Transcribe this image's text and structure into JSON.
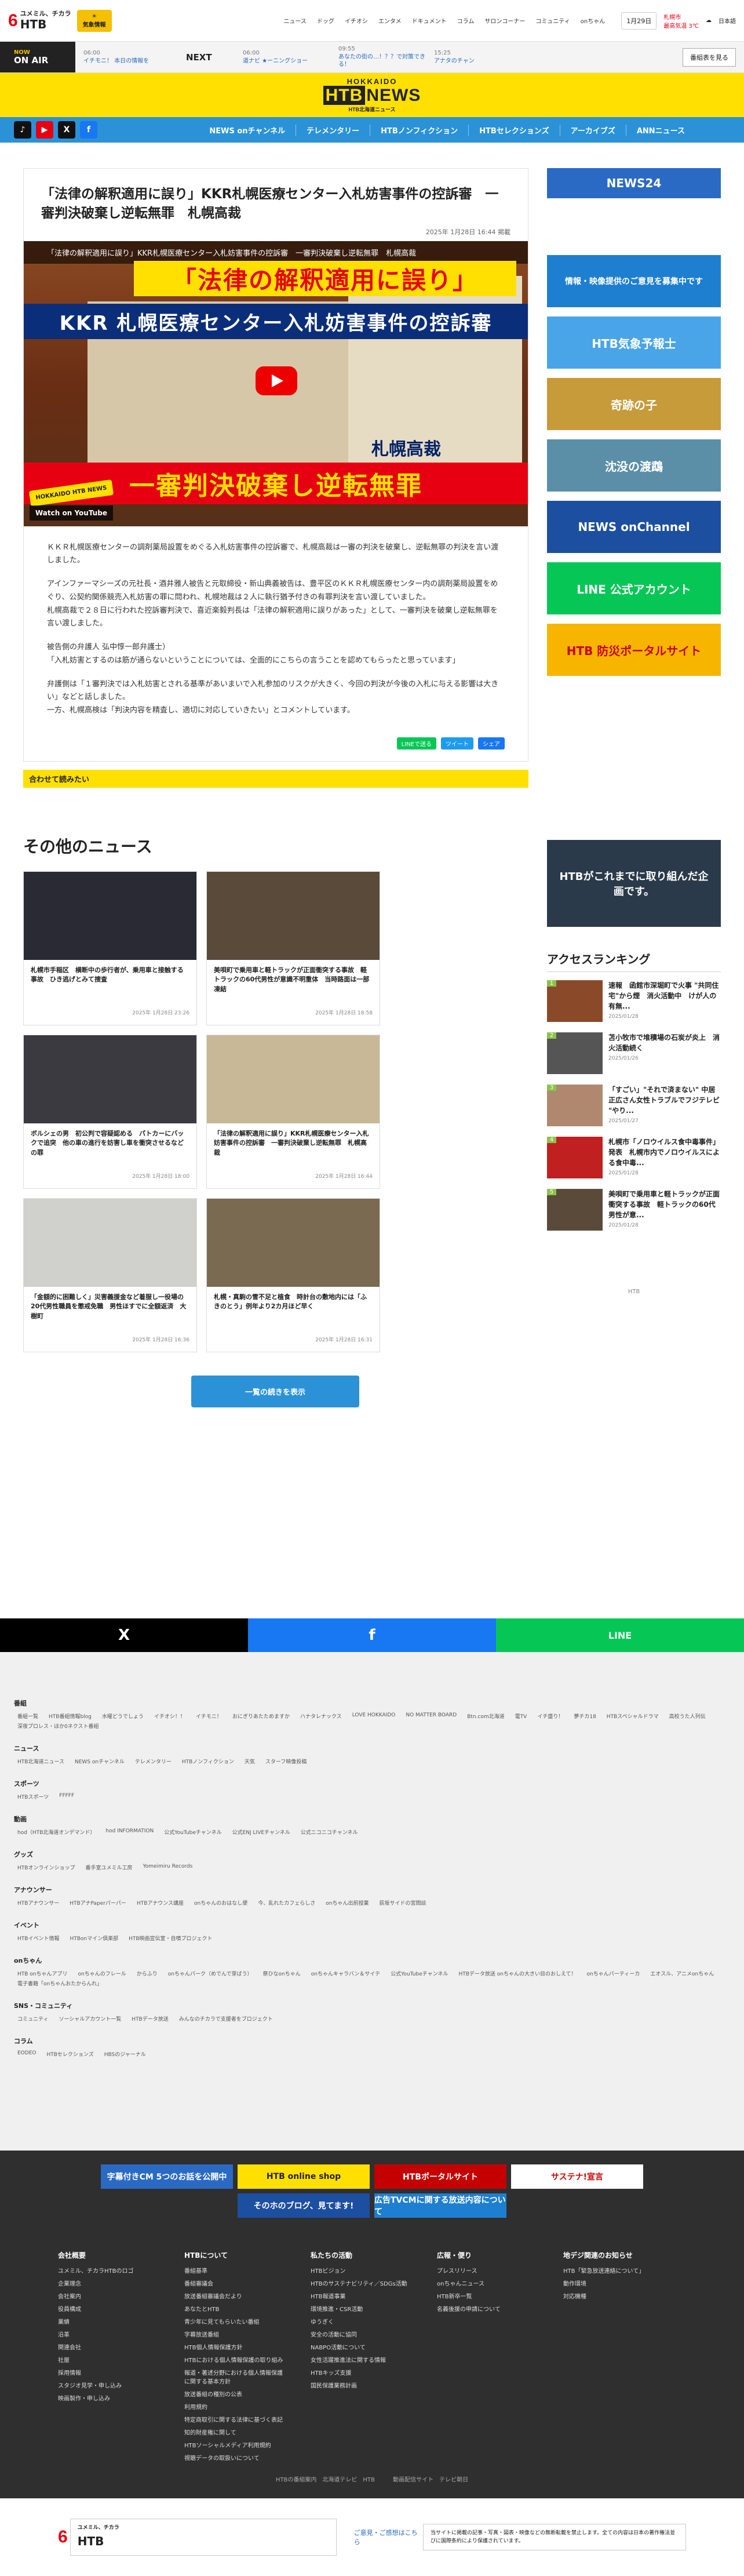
{
  "header": {
    "logo_small": "ユメミル、チカラ",
    "logo_big": "HTB",
    "weather_top": "☀",
    "weather_label": "気象情報",
    "nav": [
      "ニュース",
      "ドッグ",
      "イチオシ",
      "エンタメ",
      "ドキュメント",
      "コラム",
      "サロンコーナー",
      "コミュニティ",
      "onちゃん"
    ],
    "date": "1月29日",
    "ind_label": "札幌市",
    "ind_label2": "最高気温 3℃",
    "lang": "日本語"
  },
  "onair": {
    "now_small": "NOW",
    "now": "ON AIR",
    "items": [
      {
        "time": "06:00",
        "title": "イチモニ！ 本日の情報を"
      },
      {
        "time": "06:00",
        "title": "道ナビ ★ーニングショー"
      },
      {
        "time": "09:55",
        "title": "あなたの街の…！？？で対策できる！"
      },
      {
        "time": "15:25",
        "title": "アナタのチャン"
      }
    ],
    "next": "NEXT",
    "btn": "番組表を見る"
  },
  "brand": {
    "hokkaido": "HOKKAIDO",
    "sub": "HTB北海道ニュース",
    "name": "HTB",
    "name2": "NEWS"
  },
  "social": {
    "x": "X",
    "tiktok": "♪",
    "youtube": "▶",
    "facebook": "f"
  },
  "catnav": [
    "NEWS onチャンネル",
    "テレメンタリー",
    "HTBノンフィクション",
    "HTBセレクションズ",
    "アーカイブズ",
    "ANNニュース"
  ],
  "article": {
    "title": "「法律の解釈適用に誤り」KKR札幌医療センター入札妨害事件の控訴審　一審判決破棄し逆転無罪　札幌高裁",
    "date": "2025年 1月28日 16:44 掲載",
    "video_title": "「法律の解釈適用に誤り」KKR札幌医療センター入札妨害事件の控訴審　一審判決破棄し逆転無罪　札幌高裁",
    "video_band1": "「法律の解釈適用に誤り」",
    "video_band2": "KKR 札幌医療センター入札妨害事件の控訴審",
    "video_band3": "札幌高裁",
    "video_band4": "一審判決破棄し逆転無罪",
    "watch": "Watch on YouTube",
    "hk_badge": "HOKKAIDO HTB NEWS",
    "paragraphs": [
      "ＫＫＲ札幌医療センターの調剤薬局設置をめぐる入札妨害事件の控訴審で、札幌高裁は一審の判決を破棄し、逆転無罪の判決を言い渡しました。",
      "アインファーマシーズの元社長・酒井雅人被告と元取締役・新山典義被告は、豊平区のＫＫＲ札幌医療センター内の調剤薬局設置をめぐり、公契約関係競売入札妨害の罪に問われ、札幌地裁は２人に執行猶予付きの有罪判決を言い渡していました。\n札幌高裁で２８日に行われた控訴審判決で、喜近楽毅判長は「法律の解釈適用に誤りがあった」として、一審判決を破棄し逆転無罪を言い渡しました。",
      "被告側の弁護人 弘中惇一郎弁護士）\n「入札妨害とするのは筋が通らないということについては、全面的にこちらの言うことを認めてもらったと思っています」",
      "弁護側は「１審判決では入札妨害とされる基準があいまいで入札参加のリスクが大きく、今回の判決が今後の入札に与える影響は大きい」などと話しました。\n一方、札幌高検は「判決内容を精査し、適切に対応していきたい」とコメントしています。"
    ],
    "share": [
      "LINEで送る",
      "ツイート",
      "シェア"
    ],
    "readmore": "合わせて読みたい"
  },
  "side_banners": [
    "NEWS24",
    "情報・映像提供のご意見を募集中です",
    "HTB気象予報士",
    "奇跡の子",
    "沈没の渡鵡",
    "NEWS onChannel",
    "LINE 公式アカウント",
    "HTB 防災ポータルサイト"
  ],
  "others": {
    "title": "その他のニュース",
    "cards": [
      {
        "title": "札幌市手稲区　横断中の歩行者が、乗用車と接触する事故　ひき逃げとみて捜査",
        "date": "2025年 1月28日 23:26"
      },
      {
        "title": "美唄町で乗用車と軽トラックが正面衝突する事故　軽トラックの60代男性が意識不明重体　当時路面は一部凍結",
        "date": "2025年 1月28日 18:58"
      },
      {
        "title": "ボルシェの男　初公判で容疑認める　パトカーにバックで追突　他の車の進行を妨害し車を衝突させるなどの罪",
        "date": "2025年 1月28日 18:00"
      },
      {
        "title": "「法律の解釈適用に誤り」KKR札幌医療センター入札妨害事件の控訴審　一審判決破棄し逆転無罪　札幌高裁",
        "date": "2025年 1月28日 16:44"
      },
      {
        "title": "「金額的に困難しく」災害義援金など着服し一役場の20代男性職員を懲戒免職　男性ほすでに全額返済　大樹町",
        "date": "2025年 1月28日 16:36"
      },
      {
        "title": "札幌・真駒の雪不足と植食　時計台の敷地内には「ふきのとう」例年より2カ月ほど早く",
        "date": "2025年 1月28日 16:31"
      }
    ],
    "more": "一覧の続きを表示"
  },
  "side2": {
    "banner": "HTBがこれまでに取り組んだ企画です。",
    "rank_title": "アクセスランキング",
    "ranks": [
      {
        "num": "1",
        "title": "速報　函館市深堀町で火事 \"共同住宅\"から煙　消火活動中　けが人の有無...",
        "date": "2025/01/28"
      },
      {
        "num": "2",
        "title": "苫小牧市で堆積場の石炭が炎上　消火活動続く",
        "date": "2025/01/26"
      },
      {
        "num": "3",
        "title": "「すごい」\"それで済まない\" 中居正広さん女性トラブルでフジテレビ \"やり...",
        "date": "2025/01/27"
      },
      {
        "num": "4",
        "title": "札幌市「ノロウイルス食中毒事件」発表　札幌市内でノロウイルスによる食中毒...",
        "date": "2025/01/28"
      },
      {
        "num": "5",
        "title": "美唄町で乗用車と軽トラックが正面衝突する事故　軽トラックの60代男性が意...",
        "date": "2025/01/28"
      }
    ],
    "pager": "HTB"
  },
  "sharebar": {
    "x": "X",
    "fb": "f",
    "line": "LINE"
  },
  "sitemap": [
    {
      "h": "番組",
      "items": [
        "番組一覧",
        "HTB番組情報blog",
        "水曜どうでしょう",
        "イチオシ！！",
        "イチモニ！",
        "おにぎりあたためますか",
        "ハナタレナックス",
        "LOVE HOKKAIDO",
        "NO MATTER BOARD",
        "Btn.com北海道",
        "電TV",
        "イチ盛り！",
        "夢チカ18",
        "HTBスペシャルドラマ",
        "高校うた人列伝",
        "深夜プロレス・ほか0ネクスト番組"
      ]
    },
    {
      "h": "ニュース",
      "items": [
        "HTB北海道ニュース",
        "NEWS onチャンネル",
        "テレメンタリー",
        "HTBノンフィクション",
        "天気",
        "スターフ映像投稿"
      ]
    },
    {
      "h": "スポーツ",
      "items": [
        "HTBスポーツ",
        "FFFFF"
      ]
    },
    {
      "h": "動画",
      "items": [
        "hod（HTB北海道オンデマンド）",
        "hod INFORMATION",
        "公式YouTubeチャンネル",
        "公式ENJ LIVEチャンネル",
        "公式ニコニコチャンネル"
      ]
    },
    {
      "h": "グッズ",
      "items": [
        "HTBオンラインショップ",
        "番手室ユメミル工房",
        "Yomeimiru Records"
      ]
    },
    {
      "h": "アナウンサー",
      "items": [
        "HTBアナウンサー",
        "HTBアナPaperパーパー",
        "HTBアナウンス講座",
        "onちゃんのおはなし便",
        "今、乱れたカフェらしさ",
        "onちゃん出前授業",
        "荻坂サイドの宮間談"
      ]
    },
    {
      "h": "イベント",
      "items": [
        "HTBイベント情報",
        "HTBonマイン倶楽部",
        "HTB映画宣伝室・自噴プロジェクト"
      ]
    },
    {
      "h": "onちゃん",
      "items": [
        "HTB onちゃんアプリ",
        "onちゃんのフレール",
        "からふり",
        "onちゃんパーク（めでんで芽ばう）",
        "祭ひなonちゃん",
        "onちゃんキャラバン＆サイテ",
        "公式YouTubeチャンネル",
        "HTBデータ放送 onちゃんの大きい目のおしえて！",
        "onちゃんパーティーカ",
        "エオスル、アニメonちゃん",
        "電子書籍「onちゃんおたからんれ」"
      ]
    },
    {
      "h": "SNS・コミュニティ",
      "items": [
        "コミュニティ",
        "ソーシャルアカウント一覧",
        "HTBデータ放送",
        "みんなのチカラで支援者をプロジェクト"
      ]
    },
    {
      "h": "コラム",
      "items": [
        "EODEO",
        "HTBセレクションズ",
        "HBSのジャーナル"
      ]
    }
  ],
  "footer": {
    "banners": [
      "字幕付きCM 5つのお話を公開中",
      "HTB online shop",
      "HTBポータルサイト",
      "サステナ!宣言",
      "そのホのブログ、見てます!",
      "広告TVCMに関する放送内容について"
    ],
    "cols": [
      {
        "h": "会社概要",
        "items": [
          "ユメミル、チカラHTBのロゴ",
          "企業理念",
          "会社案内",
          "役員構成",
          "業績",
          "沿革",
          "関連会社",
          "社屋",
          "採用情報",
          "スタジオ見学・申し込み",
          "映画製作・申し込み"
        ]
      },
      {
        "h": "HTBについて",
        "items": [
          "番組基準",
          "番組審議会",
          "放送番組審議会だより",
          "あなたとHTB",
          "青少年に見てもらいたい番組",
          "字幕放送番組",
          "HTB個人情報保護方針",
          "HTBにおける個人情報保護の取り組み",
          "報道・著述分野における個人情報保護に関する基本方針",
          "放送番組の種別の公表",
          "利用規約",
          "特定商取引に関する法律に基づく表記",
          "知的財産権に関して",
          "HTBソーシャルメディア利用規約",
          "視聴データの取扱いについて"
        ]
      },
      {
        "h": "私たちの活動",
        "items": [
          "HTBビジョン",
          "HTBのサステナビリティ／SDGs活動",
          "HTB報道事業",
          "環境推進・CSR活動",
          "ゆうぎく",
          "安全の活動に協同",
          "NABPO活動について",
          "女性活躍推進法に関する情報",
          "HTBキッズ支援",
          "国民保護業務計画"
        ]
      },
      {
        "h": "広報・便り",
        "items": [
          "プレスリリース",
          "onちゃんニュース",
          "HTB新卒一覧",
          "名義後援の申請について"
        ]
      },
      {
        "h": "地デジ関連のお知らせ",
        "items": [
          "HTB「緊急放送連絡について」",
          "動作環境",
          "対応機種"
        ]
      }
    ],
    "bottom": "HTBの番組案内　北海道テレビ　HTB 動画配信サイト　テレビ朝日"
  },
  "finfo": {
    "contact": "ご意見・ご感想はこちら",
    "text": "当サイトに掲載の記事・写真・図表・映像などの無断転載を禁止します。全ての内容は日本の著作権法並びに国際条約により保護されています。"
  }
}
